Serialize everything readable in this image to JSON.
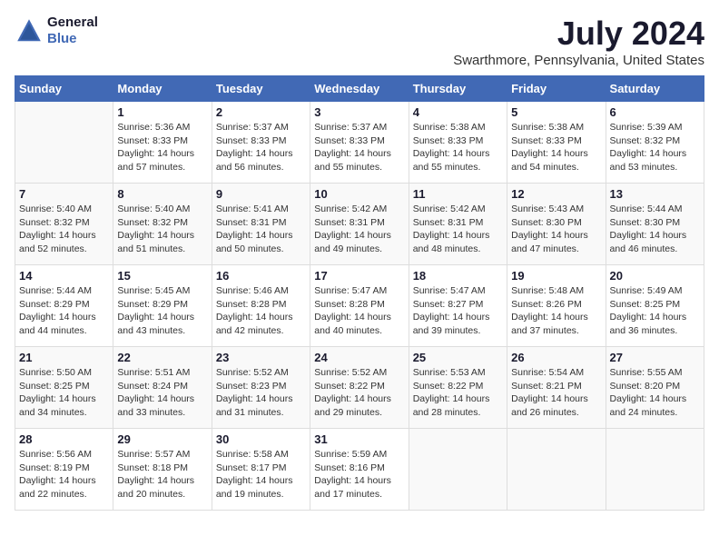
{
  "header": {
    "logo_line1": "General",
    "logo_line2": "Blue",
    "title": "July 2024",
    "subtitle": "Swarthmore, Pennsylvania, United States"
  },
  "days_of_week": [
    "Sunday",
    "Monday",
    "Tuesday",
    "Wednesday",
    "Thursday",
    "Friday",
    "Saturday"
  ],
  "weeks": [
    [
      {
        "date": "",
        "sunrise": "",
        "sunset": "",
        "daylight": ""
      },
      {
        "date": "1",
        "sunrise": "Sunrise: 5:36 AM",
        "sunset": "Sunset: 8:33 PM",
        "daylight": "Daylight: 14 hours and 57 minutes."
      },
      {
        "date": "2",
        "sunrise": "Sunrise: 5:37 AM",
        "sunset": "Sunset: 8:33 PM",
        "daylight": "Daylight: 14 hours and 56 minutes."
      },
      {
        "date": "3",
        "sunrise": "Sunrise: 5:37 AM",
        "sunset": "Sunset: 8:33 PM",
        "daylight": "Daylight: 14 hours and 55 minutes."
      },
      {
        "date": "4",
        "sunrise": "Sunrise: 5:38 AM",
        "sunset": "Sunset: 8:33 PM",
        "daylight": "Daylight: 14 hours and 55 minutes."
      },
      {
        "date": "5",
        "sunrise": "Sunrise: 5:38 AM",
        "sunset": "Sunset: 8:33 PM",
        "daylight": "Daylight: 14 hours and 54 minutes."
      },
      {
        "date": "6",
        "sunrise": "Sunrise: 5:39 AM",
        "sunset": "Sunset: 8:32 PM",
        "daylight": "Daylight: 14 hours and 53 minutes."
      }
    ],
    [
      {
        "date": "7",
        "sunrise": "Sunrise: 5:40 AM",
        "sunset": "Sunset: 8:32 PM",
        "daylight": "Daylight: 14 hours and 52 minutes."
      },
      {
        "date": "8",
        "sunrise": "Sunrise: 5:40 AM",
        "sunset": "Sunset: 8:32 PM",
        "daylight": "Daylight: 14 hours and 51 minutes."
      },
      {
        "date": "9",
        "sunrise": "Sunrise: 5:41 AM",
        "sunset": "Sunset: 8:31 PM",
        "daylight": "Daylight: 14 hours and 50 minutes."
      },
      {
        "date": "10",
        "sunrise": "Sunrise: 5:42 AM",
        "sunset": "Sunset: 8:31 PM",
        "daylight": "Daylight: 14 hours and 49 minutes."
      },
      {
        "date": "11",
        "sunrise": "Sunrise: 5:42 AM",
        "sunset": "Sunset: 8:31 PM",
        "daylight": "Daylight: 14 hours and 48 minutes."
      },
      {
        "date": "12",
        "sunrise": "Sunrise: 5:43 AM",
        "sunset": "Sunset: 8:30 PM",
        "daylight": "Daylight: 14 hours and 47 minutes."
      },
      {
        "date": "13",
        "sunrise": "Sunrise: 5:44 AM",
        "sunset": "Sunset: 8:30 PM",
        "daylight": "Daylight: 14 hours and 46 minutes."
      }
    ],
    [
      {
        "date": "14",
        "sunrise": "Sunrise: 5:44 AM",
        "sunset": "Sunset: 8:29 PM",
        "daylight": "Daylight: 14 hours and 44 minutes."
      },
      {
        "date": "15",
        "sunrise": "Sunrise: 5:45 AM",
        "sunset": "Sunset: 8:29 PM",
        "daylight": "Daylight: 14 hours and 43 minutes."
      },
      {
        "date": "16",
        "sunrise": "Sunrise: 5:46 AM",
        "sunset": "Sunset: 8:28 PM",
        "daylight": "Daylight: 14 hours and 42 minutes."
      },
      {
        "date": "17",
        "sunrise": "Sunrise: 5:47 AM",
        "sunset": "Sunset: 8:28 PM",
        "daylight": "Daylight: 14 hours and 40 minutes."
      },
      {
        "date": "18",
        "sunrise": "Sunrise: 5:47 AM",
        "sunset": "Sunset: 8:27 PM",
        "daylight": "Daylight: 14 hours and 39 minutes."
      },
      {
        "date": "19",
        "sunrise": "Sunrise: 5:48 AM",
        "sunset": "Sunset: 8:26 PM",
        "daylight": "Daylight: 14 hours and 37 minutes."
      },
      {
        "date": "20",
        "sunrise": "Sunrise: 5:49 AM",
        "sunset": "Sunset: 8:25 PM",
        "daylight": "Daylight: 14 hours and 36 minutes."
      }
    ],
    [
      {
        "date": "21",
        "sunrise": "Sunrise: 5:50 AM",
        "sunset": "Sunset: 8:25 PM",
        "daylight": "Daylight: 14 hours and 34 minutes."
      },
      {
        "date": "22",
        "sunrise": "Sunrise: 5:51 AM",
        "sunset": "Sunset: 8:24 PM",
        "daylight": "Daylight: 14 hours and 33 minutes."
      },
      {
        "date": "23",
        "sunrise": "Sunrise: 5:52 AM",
        "sunset": "Sunset: 8:23 PM",
        "daylight": "Daylight: 14 hours and 31 minutes."
      },
      {
        "date": "24",
        "sunrise": "Sunrise: 5:52 AM",
        "sunset": "Sunset: 8:22 PM",
        "daylight": "Daylight: 14 hours and 29 minutes."
      },
      {
        "date": "25",
        "sunrise": "Sunrise: 5:53 AM",
        "sunset": "Sunset: 8:22 PM",
        "daylight": "Daylight: 14 hours and 28 minutes."
      },
      {
        "date": "26",
        "sunrise": "Sunrise: 5:54 AM",
        "sunset": "Sunset: 8:21 PM",
        "daylight": "Daylight: 14 hours and 26 minutes."
      },
      {
        "date": "27",
        "sunrise": "Sunrise: 5:55 AM",
        "sunset": "Sunset: 8:20 PM",
        "daylight": "Daylight: 14 hours and 24 minutes."
      }
    ],
    [
      {
        "date": "28",
        "sunrise": "Sunrise: 5:56 AM",
        "sunset": "Sunset: 8:19 PM",
        "daylight": "Daylight: 14 hours and 22 minutes."
      },
      {
        "date": "29",
        "sunrise": "Sunrise: 5:57 AM",
        "sunset": "Sunset: 8:18 PM",
        "daylight": "Daylight: 14 hours and 20 minutes."
      },
      {
        "date": "30",
        "sunrise": "Sunrise: 5:58 AM",
        "sunset": "Sunset: 8:17 PM",
        "daylight": "Daylight: 14 hours and 19 minutes."
      },
      {
        "date": "31",
        "sunrise": "Sunrise: 5:59 AM",
        "sunset": "Sunset: 8:16 PM",
        "daylight": "Daylight: 14 hours and 17 minutes."
      },
      {
        "date": "",
        "sunrise": "",
        "sunset": "",
        "daylight": ""
      },
      {
        "date": "",
        "sunrise": "",
        "sunset": "",
        "daylight": ""
      },
      {
        "date": "",
        "sunrise": "",
        "sunset": "",
        "daylight": ""
      }
    ]
  ]
}
